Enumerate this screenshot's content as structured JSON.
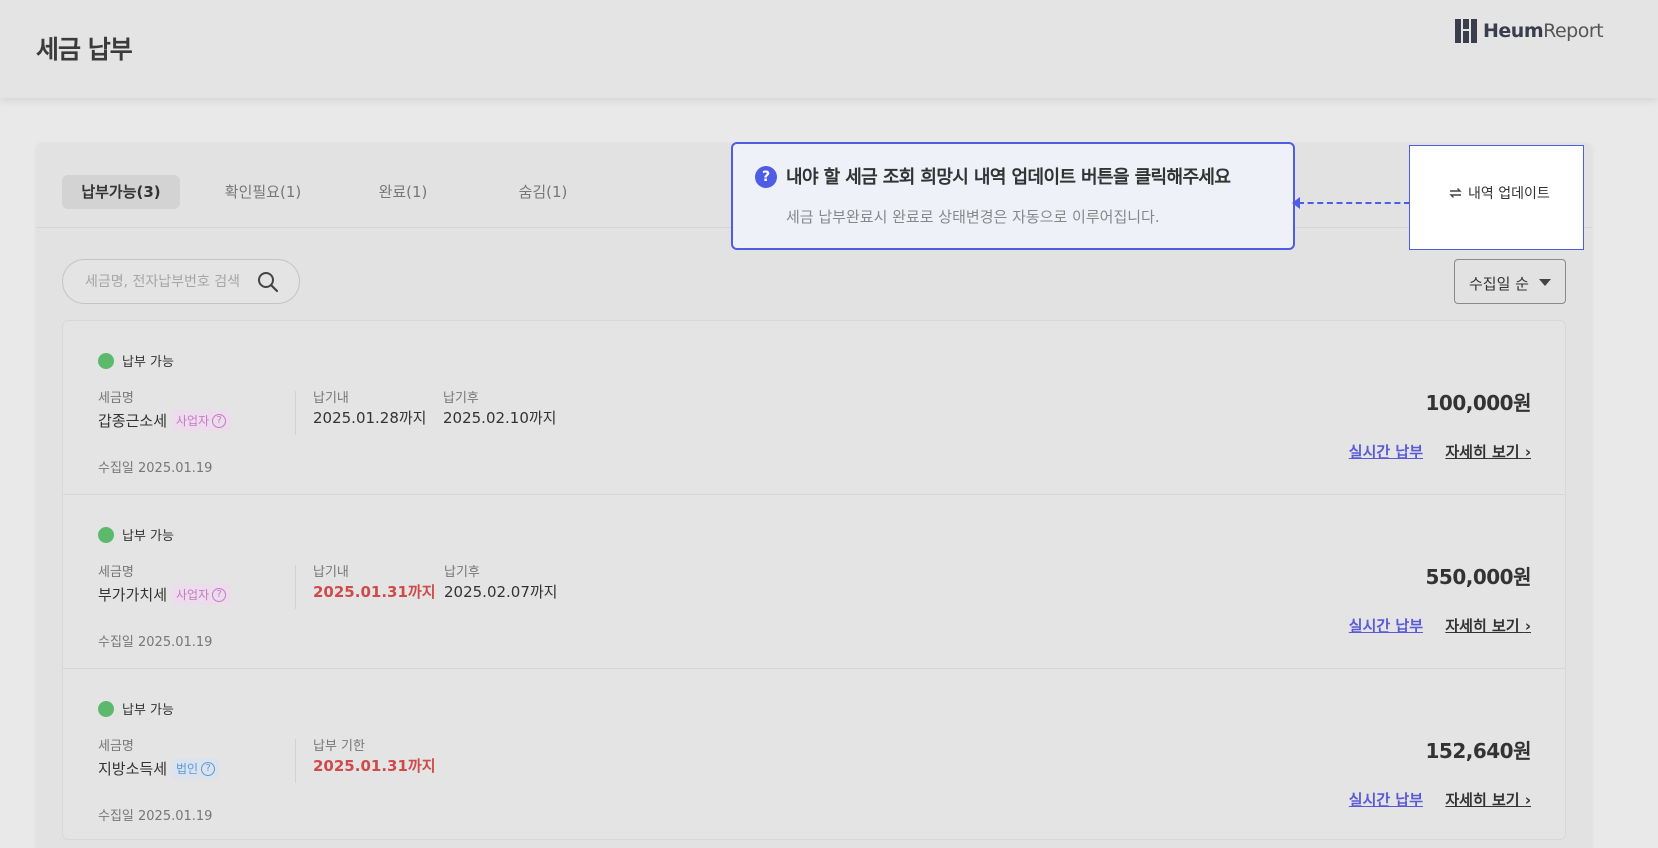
{
  "header": {
    "title": "세금 납부",
    "logo": {
      "brand_bold": "Heum",
      "brand_light": "Report"
    }
  },
  "tabs": [
    {
      "label": "납부가능(3)",
      "active": true
    },
    {
      "label": "확인필요(1)",
      "active": false
    },
    {
      "label": "완료(1)",
      "active": false
    },
    {
      "label": "숨김(1)",
      "active": false
    }
  ],
  "search": {
    "placeholder": "세금명, 전자납부번호 검색",
    "value": ""
  },
  "sort": {
    "selected": "수집일 순"
  },
  "update_button": {
    "label": "내역 업데이트"
  },
  "tooltip": {
    "title": "내야 할 세금 조회 희망시 내역 업데이트 버튼을 클릭해주세요",
    "subtitle": "세금 납부완료시 완료로 상태변경은 자동으로 이루어집니다."
  },
  "items": [
    {
      "status": "납부 가능",
      "name_label": "세금명",
      "name": "갑종근소세",
      "tag": "사업자",
      "due1_label": "납기내",
      "due1": "2025.01.28까지",
      "due2_label": "납기후",
      "due2": "2025.02.10까지",
      "collected": "수집일 2025.01.19",
      "amount": "100,000원",
      "pay": "실시간 납부",
      "detail": "자세히 보기"
    },
    {
      "status": "납부 가능",
      "name_label": "세금명",
      "name": "부가가치세",
      "tag": "사업자",
      "due1_label": "납기내",
      "due1": "2025.01.31까지",
      "due2_label": "납기후",
      "due2": "2025.02.07까지",
      "collected": "수집일 2025.01.19",
      "amount": "550,000원",
      "pay": "실시간 납부",
      "detail": "자세히 보기"
    },
    {
      "status": "납부 가능",
      "name_label": "세금명",
      "name": "지방소득세",
      "tag": "법인",
      "due1_label": "납부 기한",
      "due1": "2025.01.31까지",
      "collected": "수집일 2025.01.19",
      "amount": "152,640원",
      "pay": "실시간 납부",
      "detail": "자세히 보기"
    }
  ],
  "colors": {
    "accent": "#4f5ce6",
    "status_green": "#5cb96c",
    "urgent_red": "#cf4a4a",
    "link_blue": "#5a5ad8"
  }
}
